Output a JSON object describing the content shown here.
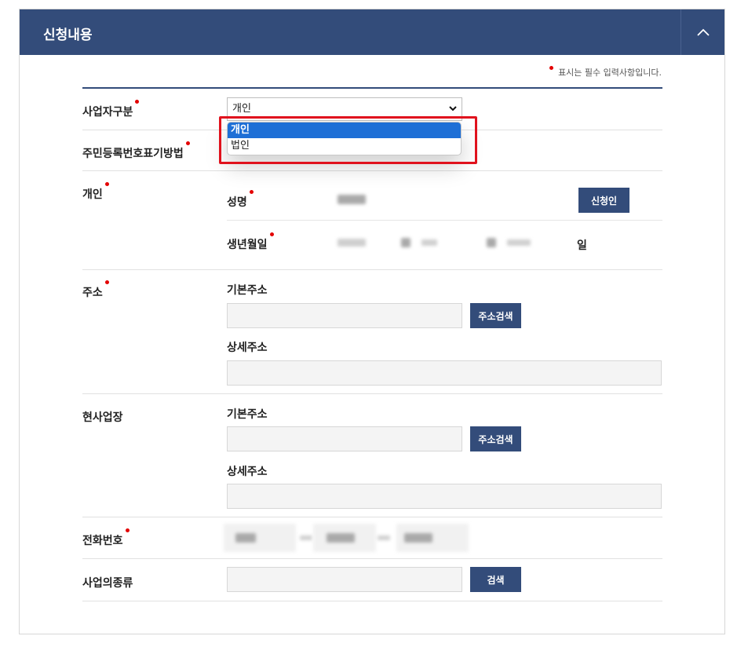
{
  "header": {
    "title": "신청내용"
  },
  "required_note": "표시는 필수 입력사항입니다.",
  "rows": {
    "business_type": {
      "label": "사업자구분",
      "selected": "개인",
      "options": [
        "개인",
        "법인"
      ]
    },
    "resident_number": {
      "label": "주민등록번호표기방법"
    },
    "individual": {
      "label": "개인",
      "name_label": "성명",
      "applicant_button": "신청인",
      "birth_label": "생년월일",
      "day_suffix": "일"
    },
    "address": {
      "label": "주소",
      "basic_label": "기본주소",
      "search_button": "주소검색",
      "detail_label": "상세주소"
    },
    "business_site": {
      "label": "현사업장",
      "basic_label": "기본주소",
      "search_button": "주소검색",
      "detail_label": "상세주소"
    },
    "phone": {
      "label": "전화번호"
    },
    "business_kind": {
      "label": "사업의종류",
      "search_button": "검색"
    }
  },
  "colors": {
    "header_bg": "#334c7a",
    "button_bg": "#334c7a",
    "required_dot": "#e30000",
    "highlight": "#e0121d",
    "option_selected": "#1e6fd6"
  }
}
